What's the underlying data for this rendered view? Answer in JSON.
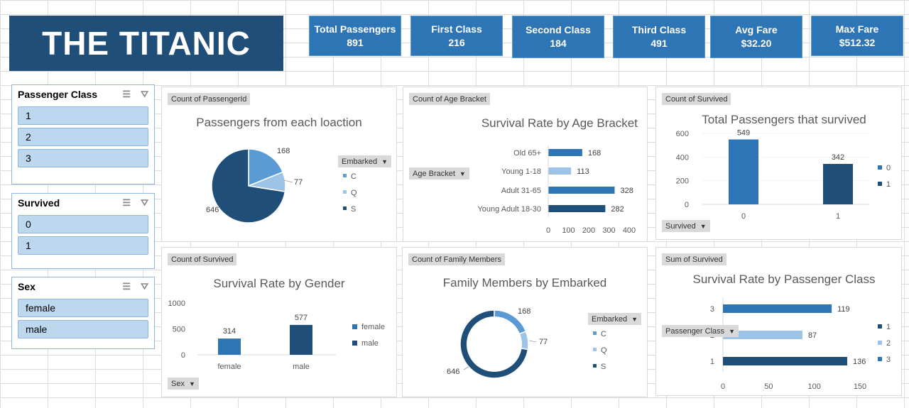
{
  "dashboard": {
    "title": "THE TITANIC",
    "kpis": [
      {
        "label": "Total Passengers",
        "value": "891"
      },
      {
        "label": "First Class",
        "value": "216"
      },
      {
        "label": "Second Class",
        "value": "184"
      },
      {
        "label": "Third Class",
        "value": "491"
      },
      {
        "label": "Avg Fare",
        "value": "$32.20"
      },
      {
        "label": "Max Fare",
        "value": "$512.32"
      }
    ]
  },
  "slicers": [
    {
      "title": "Passenger Class",
      "items": [
        "1",
        "2",
        "3"
      ]
    },
    {
      "title": "Survived",
      "items": [
        "0",
        "1"
      ]
    },
    {
      "title": "Sex",
      "items": [
        "female",
        "male"
      ]
    }
  ],
  "colors": {
    "c1": "#1f4e79",
    "c2": "#9dc3e6",
    "c3": "#5b9bd5",
    "mid": "#2e75b6"
  },
  "chart_data": [
    {
      "type": "pie",
      "field_button": "Count of PassengerId",
      "title": "Passengers from each loaction",
      "legend_field": "Embarked",
      "categories": [
        "C",
        "Q",
        "S"
      ],
      "values": [
        168,
        77,
        646
      ],
      "colors": [
        "#5b9bd5",
        "#9dc3e6",
        "#1f4e79"
      ],
      "legend_position": "right"
    },
    {
      "type": "bar",
      "orientation": "horizontal",
      "field_button": "Count of Age Bracket",
      "title": "Survival Rate by Age Bracket",
      "axis_field": "Age Bracket",
      "categories": [
        "Old 65+",
        "Young 1-18",
        "Adult 31-65",
        "Young Adult 18-30"
      ],
      "values": [
        168,
        113,
        328,
        282
      ],
      "colors": [
        "#2e75b6",
        "#9dc3e6",
        "#2e75b6",
        "#1f4e79"
      ],
      "xlim": [
        0,
        400
      ],
      "ticks": [
        "0",
        "100",
        "200",
        "300",
        "400"
      ]
    },
    {
      "type": "bar",
      "field_button": "Count of Survived",
      "title": "Total Passengers that survived",
      "axis_field": "Survived",
      "categories": [
        "0",
        "1"
      ],
      "values": [
        549,
        342
      ],
      "colors": [
        "#2e75b6",
        "#1f4e79"
      ],
      "ylim": [
        0,
        600
      ],
      "ticks": [
        "0",
        "200",
        "400",
        "600"
      ],
      "legend": [
        "0",
        "1"
      ],
      "legend_position": "right"
    },
    {
      "type": "bar",
      "field_button": "Count of Survived",
      "title": "Survival Rate by Gender",
      "axis_field": "Sex",
      "categories": [
        "female",
        "male"
      ],
      "values": [
        314,
        577
      ],
      "colors": [
        "#2e75b6",
        "#1f4e79"
      ],
      "ylim": [
        0,
        1000
      ],
      "ticks": [
        "0",
        "500",
        "1000"
      ],
      "legend": [
        "female",
        "male"
      ],
      "legend_position": "right"
    },
    {
      "type": "pie",
      "variant": "donut",
      "field_button": "Count of Family Members",
      "title": "Family Members by Embarked",
      "legend_field": "Embarked",
      "categories": [
        "C",
        "Q",
        "S"
      ],
      "values": [
        168,
        77,
        646
      ],
      "colors": [
        "#5b9bd5",
        "#9dc3e6",
        "#1f4e79"
      ],
      "legend_position": "right"
    },
    {
      "type": "bar",
      "orientation": "horizontal",
      "field_button": "Sum of Survived",
      "title": "Survival Rate by Passenger Class",
      "axis_field": "Passenger Class",
      "categories": [
        "3",
        "2",
        "1"
      ],
      "values": [
        119,
        87,
        136
      ],
      "colors": [
        "#2e75b6",
        "#9dc3e6",
        "#1f4e79"
      ],
      "xlim": [
        0,
        150
      ],
      "ticks": [
        "0",
        "50",
        "100",
        "150"
      ],
      "legend": [
        "1",
        "2",
        "3"
      ],
      "legend_position": "right"
    }
  ]
}
